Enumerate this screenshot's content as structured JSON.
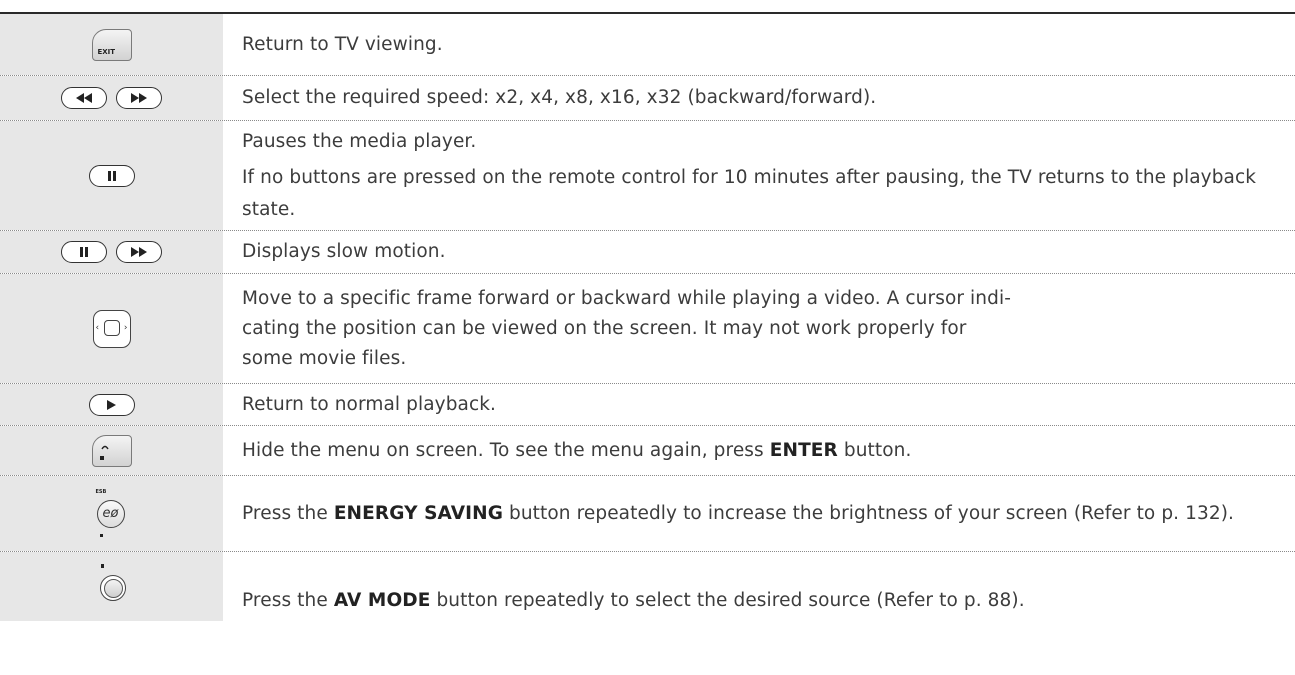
{
  "rows": [
    {
      "icons": [
        "exit-key-icon"
      ],
      "exit_label": "EXIT",
      "lines": [
        "Return to TV viewing."
      ]
    },
    {
      "icons": [
        "rewind-button-icon",
        "fast-forward-button-icon"
      ],
      "lines": [
        "Select the required speed: x2, x4, x8, x16, x32 (backward/forward)."
      ]
    },
    {
      "icons": [
        "pause-button-icon"
      ],
      "lines": [
        "Pauses the media player.",
        "If no buttons are pressed on the remote control for 10 minutes after pausing, the TV returns to the playback state."
      ]
    },
    {
      "icons": [
        "pause-button-icon",
        "fast-forward-button-icon"
      ],
      "lines": [
        "Displays slow motion."
      ]
    },
    {
      "icons": [
        "navigation-dpad-icon"
      ],
      "lines": [
        "Move to a specific frame forward or backward while playing a video. A cursor indi-",
        "cating the position can be viewed on the screen. It may not work properly for",
        "some movie files."
      ]
    },
    {
      "icons": [
        "play-button-icon"
      ],
      "lines": [
        "Return to normal playback."
      ]
    },
    {
      "icons": [
        "back-key-icon"
      ],
      "pre": "Hide the menu on screen. To see the menu again, press ",
      "bold": "ENTER",
      "post": " button."
    },
    {
      "icons": [
        "energy-saving-button-icon"
      ],
      "icon_label": "ESB",
      "pre": "Press the ",
      "bold": "ENERGY SAVING",
      "post": " button repeatedly to increase the brightness of your screen (Refer to p. 132)."
    },
    {
      "icons": [
        "av-mode-button-icon"
      ],
      "pre": "Press the ",
      "bold": "AV MODE",
      "post": " button repeatedly to select the desired source (Refer to p. 88)."
    }
  ]
}
